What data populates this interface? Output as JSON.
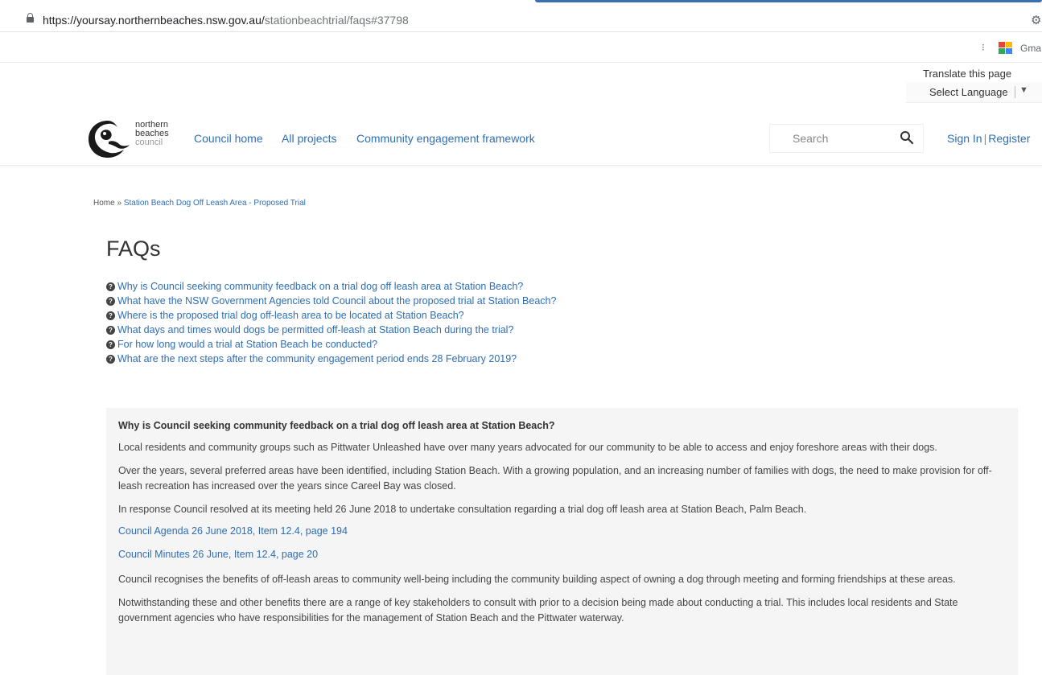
{
  "browser": {
    "url_host": "https://yoursay.northernbeaches.nsw.gov.au/",
    "url_path": "stationbeachtrial/faqs#37798",
    "bookmark_label": "Gma"
  },
  "translate": {
    "label": "Translate this page",
    "select_label": "Select Language"
  },
  "logo": {
    "line1": "northern",
    "line2": "beaches",
    "line3": "council"
  },
  "nav": {
    "items": [
      "Council home",
      "All projects",
      "Community engagement framework"
    ],
    "search_placeholder": "Search",
    "sign_in": "Sign In",
    "register": "Register"
  },
  "breadcrumb": {
    "home": "Home",
    "separator": "»",
    "current": "Station Beach Dog Off Leash Area - Proposed Trial"
  },
  "page_title": "FAQs",
  "faqs": [
    "Why is Council seeking community feedback on a trial dog off leash area at Station Beach?",
    "What have the NSW Government Agencies told Council about the proposed trial at Station Beach?",
    "Where is the proposed trial dog off-leash area to be located at Station Beach?",
    "What days and times would dogs be permitted off-leash at Station Beach during the trial?",
    "For how long would a trial at Station Beach be conducted?",
    "What are the next steps after the community engagement period ends 28 February 2019?"
  ],
  "answer": {
    "heading": "Why is Council seeking community feedback on a trial dog off leash area at Station Beach?",
    "p1": "Local residents and community groups such as Pittwater Unleashed have over many years advocated for our community to be able to access and enjoy foreshore areas with their dogs.",
    "p2": "Over the years, several preferred areas have been identified, including Station Beach. With a growing population, and an increasing number of families with dogs, the need to make provision for off-leash recreation has increased over the years since Careel Bay was closed.",
    "p3": "In response Council resolved at its meeting held 26 June 2018 to undertake consultation regarding a trial dog off leash area at Station Beach, Palm Beach.",
    "link1": "Council Agenda 26 June 2018, Item 12.4, page 194",
    "link2": "Council Minutes 26 June, Item 12.4, page 20",
    "p4": "Council recognises the benefits of off-leash areas to community well-being including the community building aspect of owning a dog through meeting and forming friendships at these areas.",
    "p5": "Notwithstanding these and other benefits there are a range of key stakeholders to consult with prior to a decision being made about conducting a trial. This includes local residents and State government agencies who have responsibilities for the management of Station Beach and the Pittwater waterway."
  },
  "colors": {
    "link": "#2e6eb5",
    "panel_bg": "#f5f5f5",
    "text": "#333333"
  },
  "icons": [
    "lock-icon",
    "extension-icon",
    "kebab-icon",
    "google-apps-icon",
    "dropdown-arrow-icon",
    "search-icon",
    "question-circle-icon"
  ]
}
